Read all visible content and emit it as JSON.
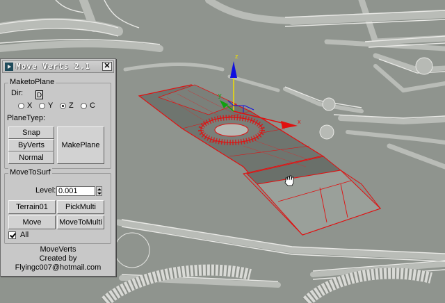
{
  "window": {
    "title": "Move Verts 2.1",
    "close_label": "✕"
  },
  "make_to_plane": {
    "group_title": "MaketoPlane",
    "dir_label": "Dir:",
    "dir_value": "D",
    "axes": [
      {
        "label": "X",
        "selected": false
      },
      {
        "label": "Y",
        "selected": false
      },
      {
        "label": "Z",
        "selected": true
      },
      {
        "label": "C",
        "selected": false
      }
    ],
    "plane_type_label": "PlaneTyep:",
    "snap_label": "Snap",
    "byverts_label": "ByVerts",
    "normal_label": "Normal",
    "makeplane_label": "MakePlane"
  },
  "move_to_surf": {
    "group_title": "MoveToSurf",
    "level_label": "Level:",
    "level_value": "0.001",
    "terrain_label": "Terrain01",
    "pickmulti_label": "PickMulti",
    "move_label": "Move",
    "movetomulti_label": "MoveToMulti",
    "all_label": "All",
    "all_checked": true
  },
  "credits": {
    "line1": "MoveVerts",
    "line2": "Created by",
    "line3": "Flyingc007@hotmail.com"
  },
  "viewport": {
    "axis_x": "x",
    "axis_y": "y",
    "axis_z": "z",
    "colors": {
      "ground": "#8f948e",
      "road": "#b7bab5",
      "selection": "#e01010",
      "gizmo_blue": "#1010e0",
      "gizmo_yellow": "#f0e000"
    }
  }
}
